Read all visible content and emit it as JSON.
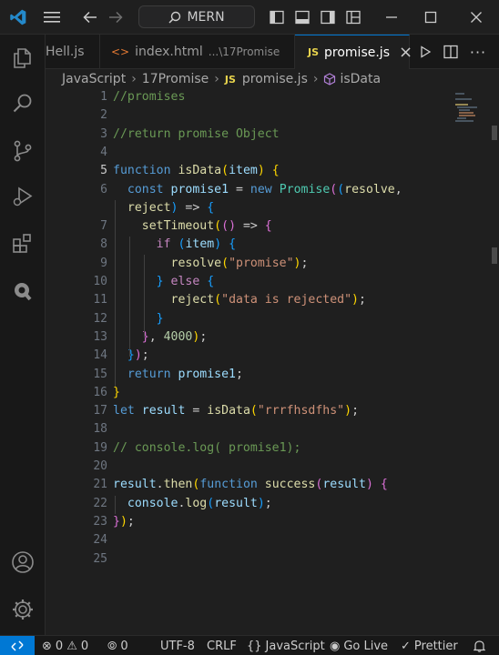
{
  "titlebar": {
    "search_label": "MERN"
  },
  "tabs": [
    {
      "label": "Hell.js",
      "icon": "js-file-icon"
    },
    {
      "label": "index.html",
      "description": "...\\17Promise",
      "icon": "html-file-icon"
    },
    {
      "label": "promise.js",
      "icon": "js-file-icon",
      "active": true,
      "close": "×"
    }
  ],
  "breadcrumb": {
    "folder1": "JavaScript",
    "folder2": "17Promise",
    "file": "promise.js",
    "symbol": "isData",
    "js_badge": "JS"
  },
  "editor": {
    "current_line": 5,
    "line_numbers": [
      "1",
      "2",
      "3",
      "4",
      "5",
      "6",
      "",
      "7",
      "8",
      "9",
      "10",
      "11",
      "12",
      "13",
      "14",
      "15",
      "16",
      "17",
      "18",
      "19",
      "20",
      "21",
      "22",
      "23",
      "24",
      "25"
    ],
    "lines": [
      "//promises",
      "",
      "//return promise Object",
      "",
      "function isData(item) {",
      "  const promise1 = new Promise((resolve,",
      "  reject) => {",
      "    setTimeout(() => {",
      "      if (item) {",
      "        resolve(\"promise\");",
      "      } else {",
      "        reject(\"data is rejected\");",
      "      }",
      "    }, 4000);",
      "  });",
      "  return promise1;",
      "}",
      "let result = isData(\"rrrfhsdfhs\");",
      "",
      "// console.log( promise1);",
      "",
      "result.then(function success(result) {",
      "  console.log(result);",
      "});",
      "",
      ""
    ]
  },
  "statusbar": {
    "errors": "0",
    "warnings": "0",
    "ports": "0",
    "encoding": "UTF-8",
    "eol": "CRLF",
    "language": "JavaScript",
    "go_live": "Go Live",
    "prettier": "Prettier"
  },
  "colors": {
    "accent": "#0078d4",
    "keyword": "#569cd6",
    "function": "#dcdcaa",
    "string": "#ce9178",
    "comment": "#6a9955"
  }
}
